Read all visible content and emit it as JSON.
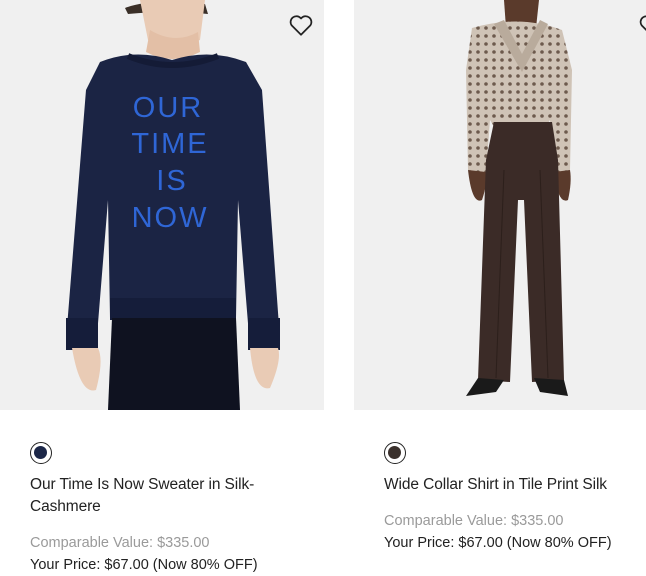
{
  "products": [
    {
      "name": "Our Time Is Now Sweater in Silk-Cashmere",
      "sweater_text": [
        "OUR",
        "TIME",
        "IS",
        "NOW"
      ],
      "comparable": "Comparable Value: $335.00",
      "price": "Your Price: $67.00 (Now 80% OFF)",
      "swatch_color": "#1c2748",
      "wishlist_icon": "heart-outline-icon"
    },
    {
      "name": "Wide Collar Shirt in Tile Print Silk",
      "comparable": "Comparable Value: $335.00",
      "price": "Your Price: $67.00 (Now 80% OFF)",
      "swatch_color": "#3a302c",
      "wishlist_icon": "heart-outline-icon"
    }
  ],
  "colors": {
    "image_bg": "#f0f0f0",
    "muted_text": "#9a9a9a",
    "text": "#222222"
  }
}
